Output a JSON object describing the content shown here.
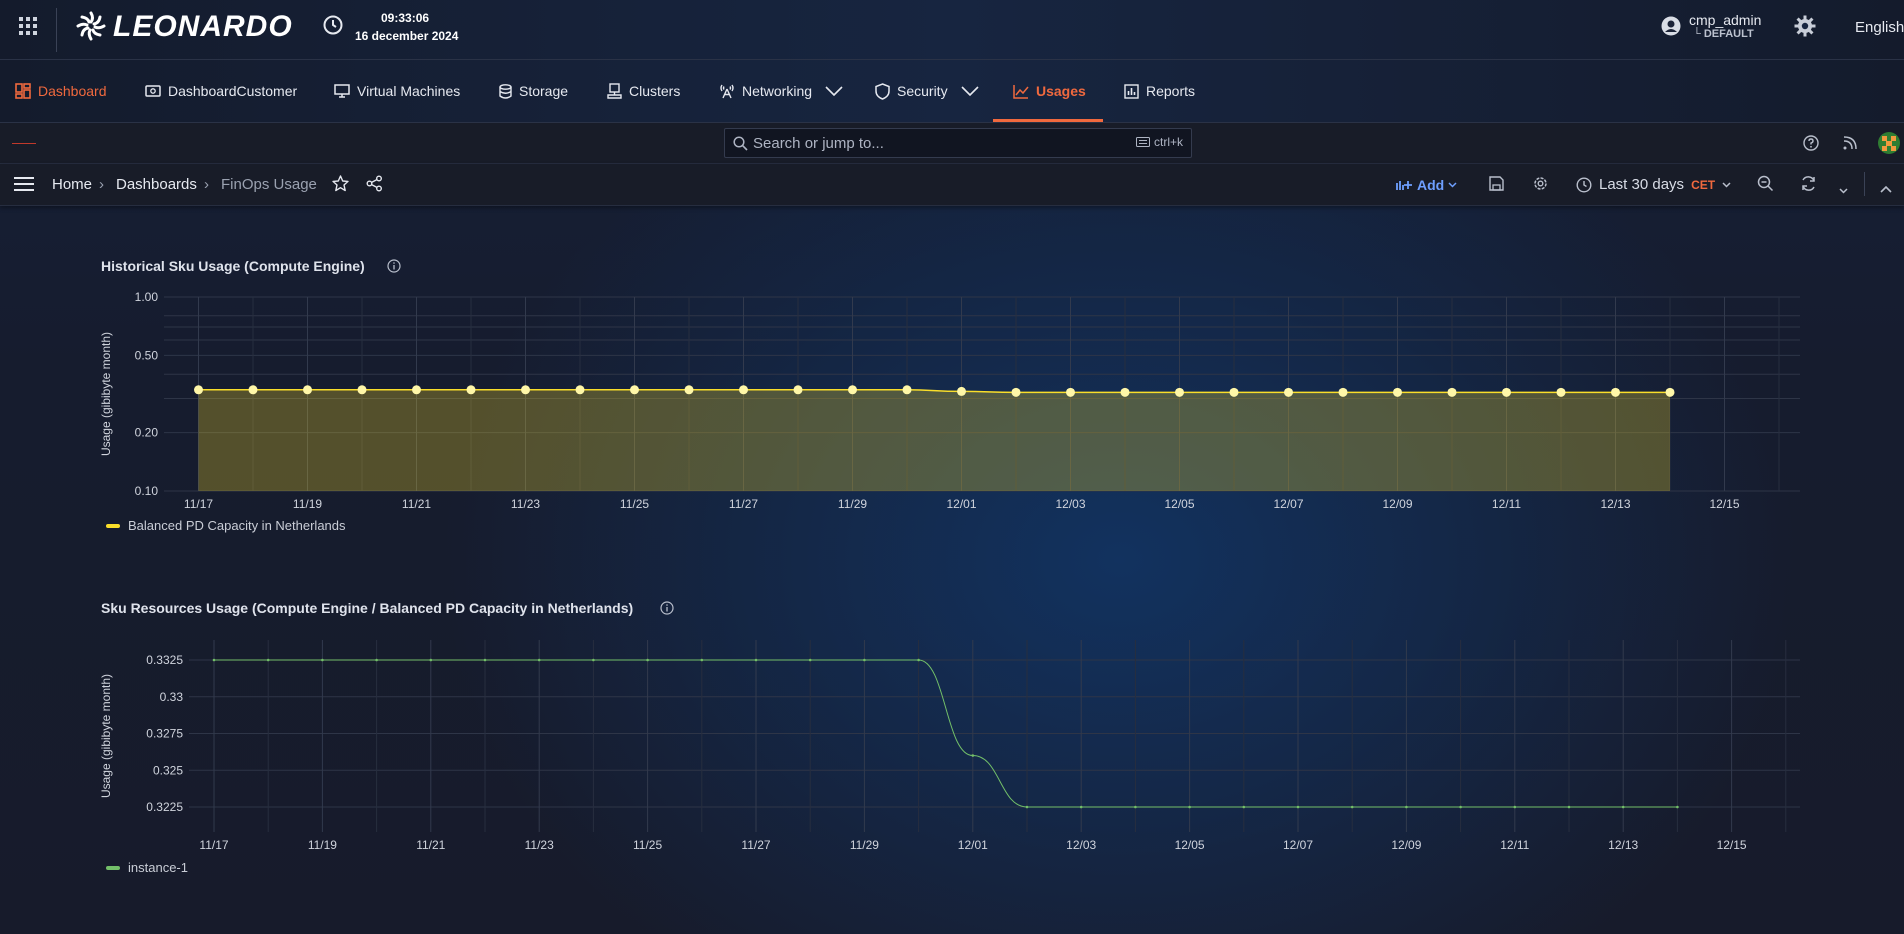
{
  "app": {
    "brand": "LEONARDO",
    "time": "09:33:06",
    "date": "16 december 2024",
    "user": "cmp_admin",
    "tenant": "└ DEFAULT",
    "language": "English"
  },
  "nav": [
    {
      "label": "Dashboard",
      "icon": "dashboard-icon"
    },
    {
      "label": "DashboardCustomer",
      "icon": "money-icon"
    },
    {
      "label": "Virtual Machines",
      "icon": "monitor-icon"
    },
    {
      "label": "Storage",
      "icon": "database-icon"
    },
    {
      "label": "Clusters",
      "icon": "cluster-icon"
    },
    {
      "label": "Networking",
      "icon": "antenna-icon"
    },
    {
      "label": "Security",
      "icon": "shield-icon"
    },
    {
      "label": "Usages",
      "icon": "chart-icon"
    },
    {
      "label": "Reports",
      "icon": "report-icon"
    }
  ],
  "search": {
    "placeholder": "Search or jump to...",
    "shortcut": "ctrl+k"
  },
  "breadcrumb": {
    "home": "Home",
    "dashboards": "Dashboards",
    "current": "FinOps Usage"
  },
  "toolbar": {
    "add": "Add",
    "time_range": "Last 30 days",
    "timezone": "CET"
  },
  "colors": {
    "accent": "#f0693e",
    "series1": "#fade2a",
    "series2": "#73bf69",
    "link": "#6e9fff"
  },
  "chart_data": [
    {
      "type": "area",
      "title": "Historical Sku Usage (Compute Engine)",
      "ylabel": "Usage (gibibyte month)",
      "yscale": "log",
      "ylim": [
        0.1,
        1.0
      ],
      "yticks": [
        "1.00",
        "0.50",
        "0.20",
        "0.10"
      ],
      "x_tick_labels": [
        "11/17",
        "11/19",
        "11/21",
        "11/23",
        "11/25",
        "11/27",
        "11/29",
        "12/01",
        "12/03",
        "12/05",
        "12/07",
        "12/09",
        "12/11",
        "12/13",
        "12/15"
      ],
      "x": [
        "11/17",
        "11/18",
        "11/19",
        "11/20",
        "11/21",
        "11/22",
        "11/23",
        "11/24",
        "11/25",
        "11/26",
        "11/27",
        "11/28",
        "11/29",
        "11/30",
        "12/01",
        "12/02",
        "12/03",
        "12/04",
        "12/05",
        "12/06",
        "12/07",
        "12/08",
        "12/09",
        "12/10",
        "12/11",
        "12/12",
        "12/13",
        "12/14"
      ],
      "series": [
        {
          "name": "Balanced PD Capacity in Netherlands",
          "values": [
            0.3325,
            0.3325,
            0.3325,
            0.3325,
            0.3325,
            0.3325,
            0.3325,
            0.3325,
            0.3325,
            0.3325,
            0.3325,
            0.3325,
            0.3325,
            0.3325,
            0.326,
            0.3225,
            0.3225,
            0.3225,
            0.3225,
            0.3225,
            0.3225,
            0.3225,
            0.3225,
            0.3225,
            0.3225,
            0.3225,
            0.3225,
            0.3225
          ]
        }
      ],
      "grid": true,
      "legend": "bottom-left"
    },
    {
      "type": "line",
      "title": "Sku Resources Usage (Compute Engine / Balanced PD Capacity in Netherlands)",
      "ylabel": "Usage (gibibyte month)",
      "ylim": [
        0.3215,
        0.3335
      ],
      "yticks": [
        "0.3325",
        "0.33",
        "0.3275",
        "0.325",
        "0.3225"
      ],
      "x_tick_labels": [
        "11/17",
        "11/19",
        "11/21",
        "11/23",
        "11/25",
        "11/27",
        "11/29",
        "12/01",
        "12/03",
        "12/05",
        "12/07",
        "12/09",
        "12/11",
        "12/13",
        "12/15"
      ],
      "x": [
        "11/17",
        "11/18",
        "11/19",
        "11/20",
        "11/21",
        "11/22",
        "11/23",
        "11/24",
        "11/25",
        "11/26",
        "11/27",
        "11/28",
        "11/29",
        "11/30",
        "12/01",
        "12/02",
        "12/03",
        "12/04",
        "12/05",
        "12/06",
        "12/07",
        "12/08",
        "12/09",
        "12/10",
        "12/11",
        "12/12",
        "12/13",
        "12/14"
      ],
      "series": [
        {
          "name": "instance-1",
          "values": [
            0.3325,
            0.3325,
            0.3325,
            0.3325,
            0.3325,
            0.3325,
            0.3325,
            0.3325,
            0.3325,
            0.3325,
            0.3325,
            0.3325,
            0.3325,
            0.3325,
            0.326,
            0.3225,
            0.3225,
            0.3225,
            0.3225,
            0.3225,
            0.3225,
            0.3225,
            0.3225,
            0.3225,
            0.3225,
            0.3225,
            0.3225,
            0.3225
          ]
        }
      ],
      "grid": true,
      "legend": "bottom-left"
    }
  ]
}
